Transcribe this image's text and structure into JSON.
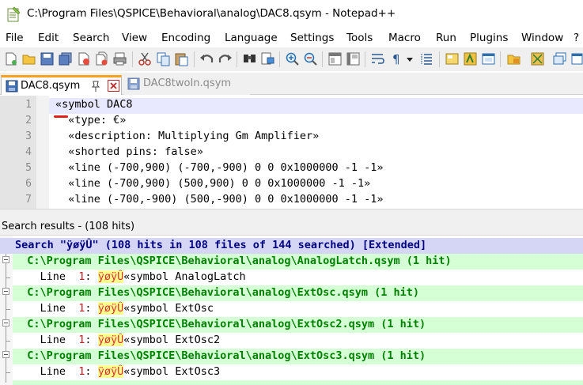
{
  "window": {
    "title": "C:\\Program Files\\QSPICE\\Behavioral\\analog\\DAC8.qsym - Notepad++"
  },
  "menu": {
    "items": [
      "File",
      "Edit",
      "Search",
      "View",
      "Encoding",
      "Language",
      "Settings",
      "Tools",
      "Macro",
      "Run",
      "Plugins",
      "Window",
      "?"
    ]
  },
  "toolbar": {
    "icons": [
      "new-file-icon",
      "open-file-icon",
      "save-icon",
      "save-all-icon",
      "close-icon",
      "close-all-icon",
      "print-icon",
      "cut-icon",
      "copy-icon",
      "paste-icon",
      "undo-icon",
      "redo-icon",
      "find-icon",
      "replace-icon",
      "zoom-in-icon",
      "zoom-out-icon",
      "sync-v-icon",
      "sync-h-icon",
      "word-wrap-icon",
      "show-all-chars-icon",
      "dropdown-icon",
      "indent-guide-icon",
      "doc-map-icon",
      "function-list-icon",
      "folder-workspace-icon"
    ]
  },
  "tabs": [
    {
      "label": "DAC8.qsym",
      "active": true
    },
    {
      "label": "DAC8twoIn.qsym",
      "active": false
    }
  ],
  "editor": {
    "lines": [
      {
        "num": "1",
        "text": "«symbol DAC8"
      },
      {
        "num": "2",
        "text": "  «type: €»"
      },
      {
        "num": "3",
        "text": "  «description: Multiplying Gm Amplifier»"
      },
      {
        "num": "4",
        "text": "  «shorted pins: false»"
      },
      {
        "num": "5",
        "text": "  «line (-700,900) (-700,-900) 0 0 0x1000000 -1 -1»"
      },
      {
        "num": "6",
        "text": "  «line (-700,900) (500,900) 0 0 0x1000000 -1 -1»"
      },
      {
        "num": "7",
        "text": "  «line (-700,-900) (500,-900) 0 0 0x1000000 -1 -1»"
      }
    ]
  },
  "search_results": {
    "header": "Search results - (108 hits)",
    "summary": "Search \"ÿøÿÛ\" (108 hits in 108 files of 144 searched) [Extended]",
    "files": [
      {
        "path": "  C:\\Program Files\\QSPICE\\Behavioral\\analog\\AnalogLatch.qsym (1 hit)",
        "line_prefix": "    Line  ",
        "line_num": "1",
        "line_sep": ": ",
        "hit": "ÿøÿÛ",
        "rest": "«symbol AnalogLatch"
      },
      {
        "path": "  C:\\Program Files\\QSPICE\\Behavioral\\analog\\ExtOsc.qsym (1 hit)",
        "line_prefix": "    Line  ",
        "line_num": "1",
        "line_sep": ": ",
        "hit": "ÿøÿÛ",
        "rest": "«symbol ExtOsc"
      },
      {
        "path": "  C:\\Program Files\\QSPICE\\Behavioral\\analog\\ExtOsc2.qsym (1 hit)",
        "line_prefix": "    Line  ",
        "line_num": "1",
        "line_sep": ": ",
        "hit": "ÿøÿÛ",
        "rest": "«symbol ExtOsc2"
      },
      {
        "path": "  C:\\Program Files\\QSPICE\\Behavioral\\analog\\ExtOsc3.qsym (1 hit)",
        "line_prefix": "    Line  ",
        "line_num": "1",
        "line_sep": ": ",
        "hit": "ÿøÿÛ",
        "rest": "«symbol ExtOsc3"
      }
    ]
  },
  "colors": {
    "active_tab_accent": "#f8a11c",
    "search_row_bg": "#d5d5f5",
    "file_row_bg": "#d5ffd5",
    "hit_highlight": "#ffff90"
  }
}
